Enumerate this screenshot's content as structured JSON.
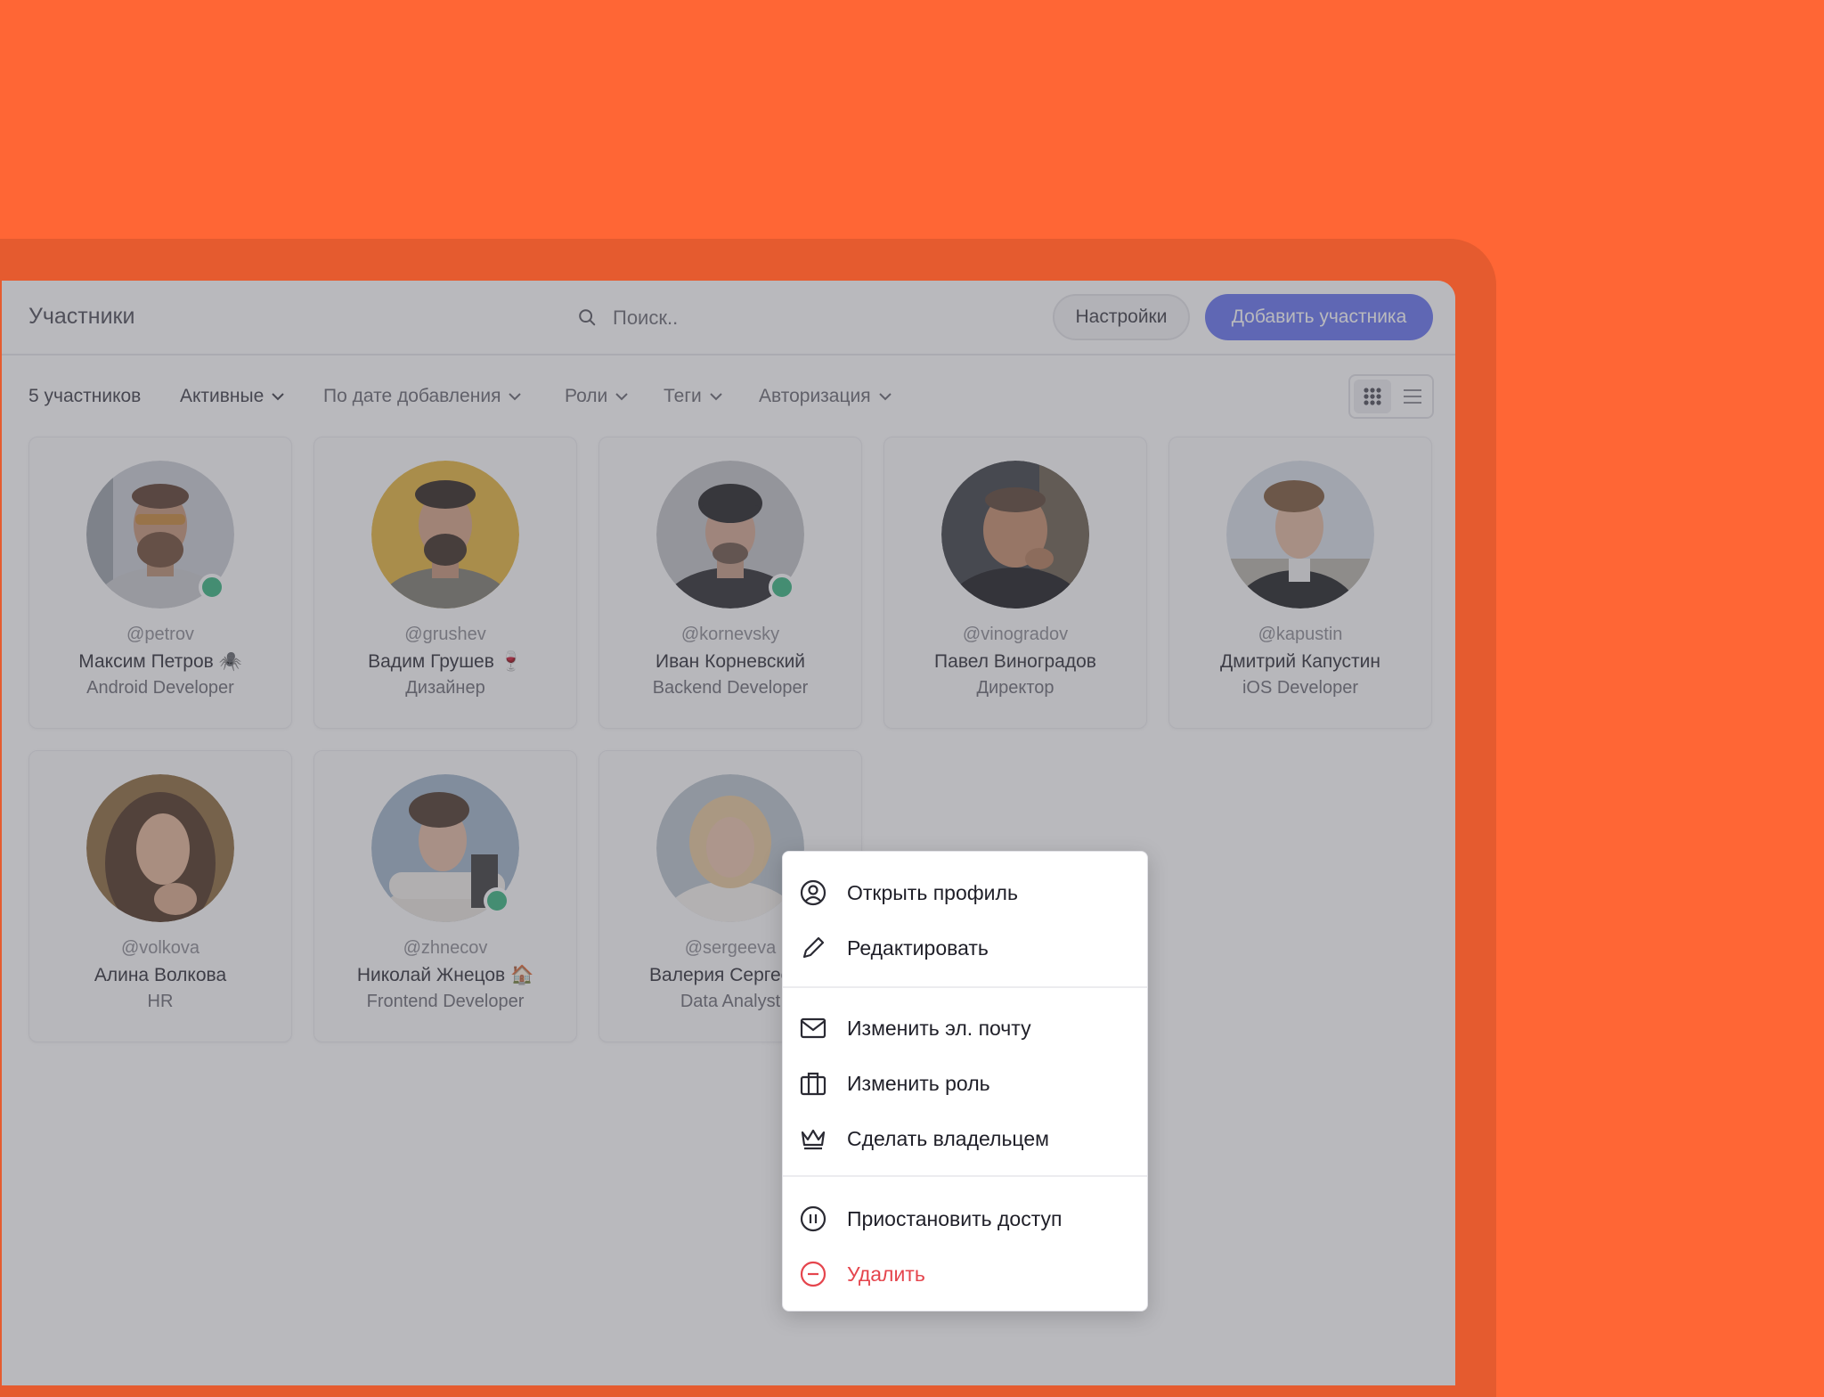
{
  "header": {
    "title": "Участники",
    "search_placeholder": "Поиск..",
    "settings_label": "Настройки",
    "add_label": "Добавить участника",
    "accent": "#6472F0"
  },
  "filters": {
    "count": "5 участников",
    "status": "Активные",
    "sort": "По дате добавления",
    "roles": "Роли",
    "tags": "Теги",
    "auth": "Авторизация",
    "views": [
      "grid-icon",
      "list-icon"
    ],
    "selected_view": "grid"
  },
  "members": [
    {
      "handle": "@petrov",
      "name": "Максим Петров 🕷️",
      "role": "Android Developer",
      "online": true
    },
    {
      "handle": "@grushev",
      "name": "Вадим Грушев 🍷",
      "role": "Дизайнер",
      "online": false
    },
    {
      "handle": "@kornevsky",
      "name": "Иван Корневский",
      "role": "Backend Developer",
      "online": true
    },
    {
      "handle": "@vinogradov",
      "name": "Павел Виноградов",
      "role": "Директор",
      "online": false
    },
    {
      "handle": "@kapustin",
      "name": "Дмитрий Капустин",
      "role": "iOS Developer",
      "online": false
    },
    {
      "handle": "@volkova",
      "name": "Алина Волкова",
      "role": "HR",
      "online": false
    },
    {
      "handle": "@zhnecov",
      "name": "Николай Жнецов 🏠",
      "role": "Frontend Developer",
      "online": true
    },
    {
      "handle": "@sergeeva",
      "name": "Валерия Сергеева",
      "role": "Data Analyst",
      "online": false
    }
  ],
  "context_menu": {
    "open_profile": "Открыть профиль",
    "edit": "Редактировать",
    "change_email": "Изменить эл. почту",
    "change_role": "Изменить роль",
    "make_owner": "Сделать владельцем",
    "suspend": "Приостановить доступ",
    "delete": "Удалить",
    "danger_color": "#E5454D"
  },
  "colors": {
    "background": "#FF6635",
    "frame": "#E55B2F",
    "online": "#36B37E"
  }
}
